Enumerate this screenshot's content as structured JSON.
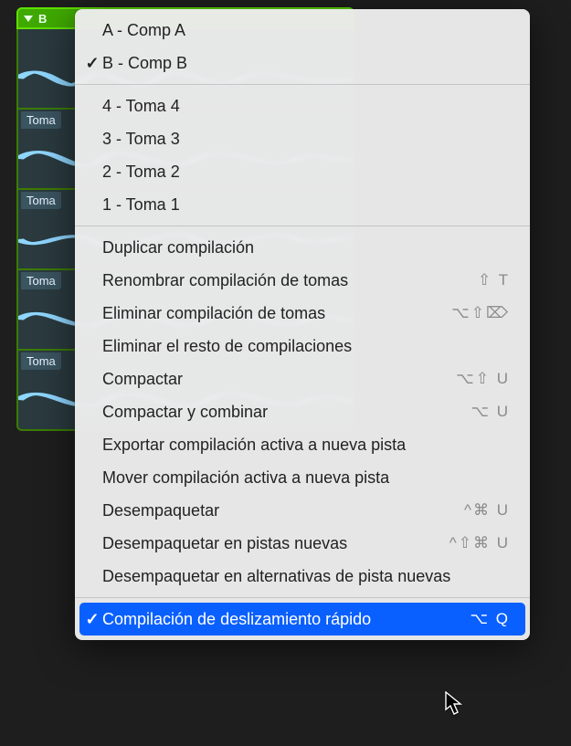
{
  "region": {
    "title": "B"
  },
  "takes": [
    {
      "label": ""
    },
    {
      "label": "Toma"
    },
    {
      "label": "Toma"
    },
    {
      "label": "Toma"
    },
    {
      "label": "Toma"
    }
  ],
  "menu": {
    "comps": [
      {
        "label": "A - Comp A",
        "checked": false
      },
      {
        "label": "B - Comp B",
        "checked": true
      }
    ],
    "takes_list": [
      {
        "label": "4 - Toma 4"
      },
      {
        "label": "3 - Toma 3"
      },
      {
        "label": "2 - Toma 2"
      },
      {
        "label": "1 - Toma 1"
      }
    ],
    "actions": [
      {
        "label": "Duplicar compilación",
        "shortcut": ""
      },
      {
        "label": "Renombrar compilación de tomas",
        "shortcut": "⇧ T"
      },
      {
        "label": "Eliminar compilación de tomas",
        "shortcut": "⌥⇧⌦"
      },
      {
        "label": "Eliminar el resto de compilaciones",
        "shortcut": ""
      },
      {
        "label": "Compactar",
        "shortcut": "⌥⇧ U"
      },
      {
        "label": "Compactar y combinar",
        "shortcut": "⌥ U"
      },
      {
        "label": "Exportar compilación activa a nueva pista",
        "shortcut": ""
      },
      {
        "label": "Mover compilación activa a nueva pista",
        "shortcut": ""
      },
      {
        "label": "Desempaquetar",
        "shortcut": "^⌘ U"
      },
      {
        "label": "Desempaquetar en pistas nuevas",
        "shortcut": "^⇧⌘ U"
      },
      {
        "label": "Desempaquetar en alternativas de pista nuevas",
        "shortcut": ""
      }
    ],
    "highlight": {
      "label": "Compilación de deslizamiento rápido",
      "shortcut": "⌥ Q",
      "checked": true
    }
  }
}
